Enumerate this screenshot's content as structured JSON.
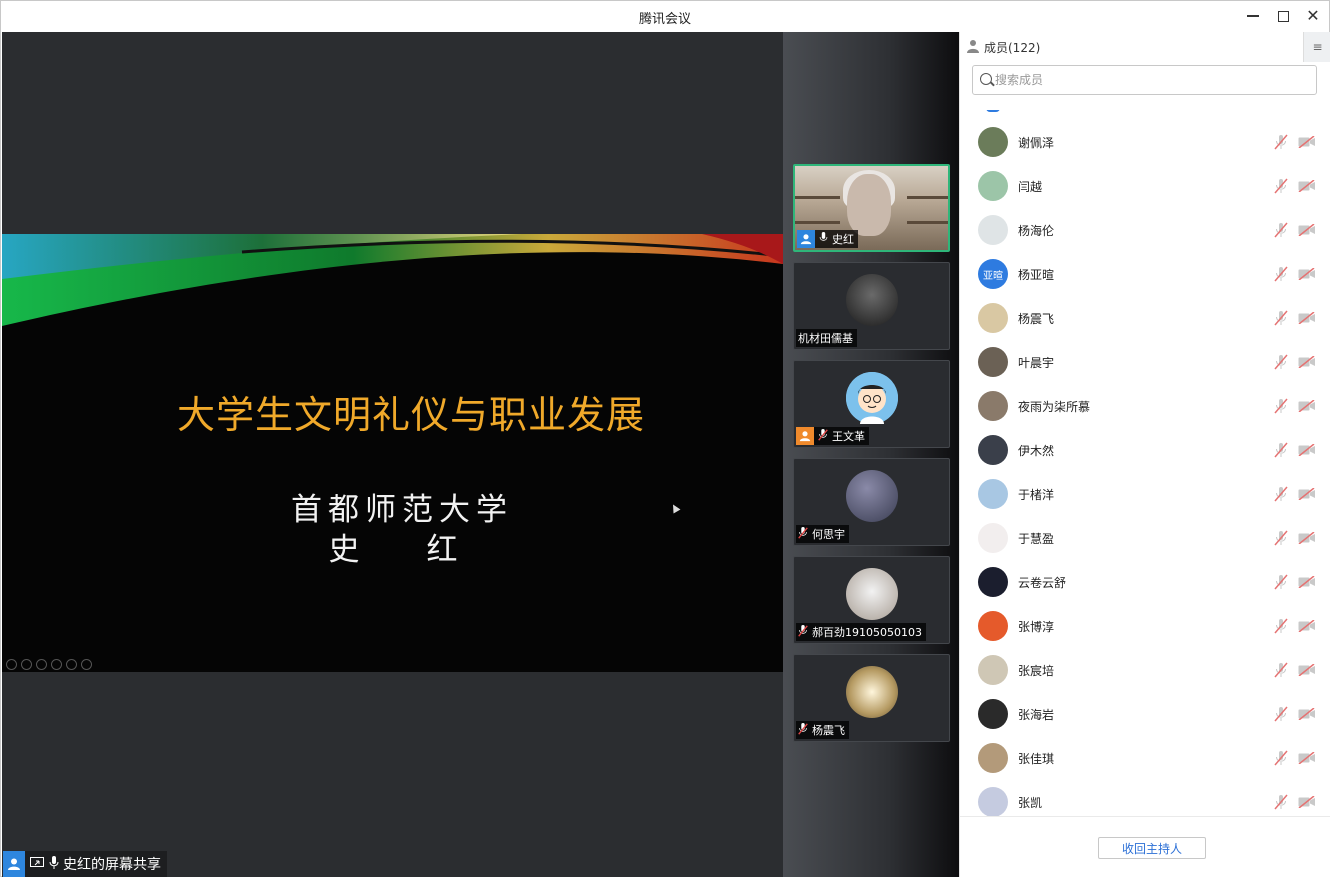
{
  "window": {
    "title": "腾讯会议"
  },
  "slide": {
    "title": "大学生文明礼仪与职业发展",
    "subtitle_line1": "首都师范大学",
    "subtitle_line2": "史　红"
  },
  "share_bar": {
    "text": "史红的屏幕共享"
  },
  "gallery": {
    "tiles": [
      {
        "name": "史红"
      },
      {
        "name": "机材田儒基"
      },
      {
        "name": "王文革"
      },
      {
        "name": "何思宇"
      },
      {
        "name": "郝百劲19105050103"
      },
      {
        "name": "杨震飞"
      }
    ]
  },
  "members_panel": {
    "title": "成员(122)",
    "search_placeholder": "搜索成员",
    "members": [
      {
        "name": "谢佩泽",
        "avatar_color": "#6b7c5a"
      },
      {
        "name": "闫越",
        "avatar_color": "#9cc5a8"
      },
      {
        "name": "杨海伦",
        "avatar_color": "#dfe4e6"
      },
      {
        "name": "杨亚暄",
        "avatar_color": "#2e7be0",
        "avatar_text": "亚暄"
      },
      {
        "name": "杨震飞",
        "avatar_color": "#d9c8a3"
      },
      {
        "name": "叶晨宇",
        "avatar_color": "#6b6155"
      },
      {
        "name": "夜雨为柒所慕",
        "avatar_color": "#8a7a6a"
      },
      {
        "name": "伊木然",
        "avatar_color": "#3a3f4a"
      },
      {
        "name": "于楮洋",
        "avatar_color": "#a8c7e3"
      },
      {
        "name": "于慧盈",
        "avatar_color": "#f2eeee"
      },
      {
        "name": "云卷云舒",
        "avatar_color": "#1b1e2e"
      },
      {
        "name": "张博淳",
        "avatar_color": "#e55a2b"
      },
      {
        "name": "张宸培",
        "avatar_color": "#cfc7b5"
      },
      {
        "name": "张海岩",
        "avatar_color": "#2a2a2a"
      },
      {
        "name": "张佳琪",
        "avatar_color": "#b39a7a"
      },
      {
        "name": "张凯",
        "avatar_color": "#c5cbe0"
      }
    ],
    "footer_button": "收回主持人"
  }
}
